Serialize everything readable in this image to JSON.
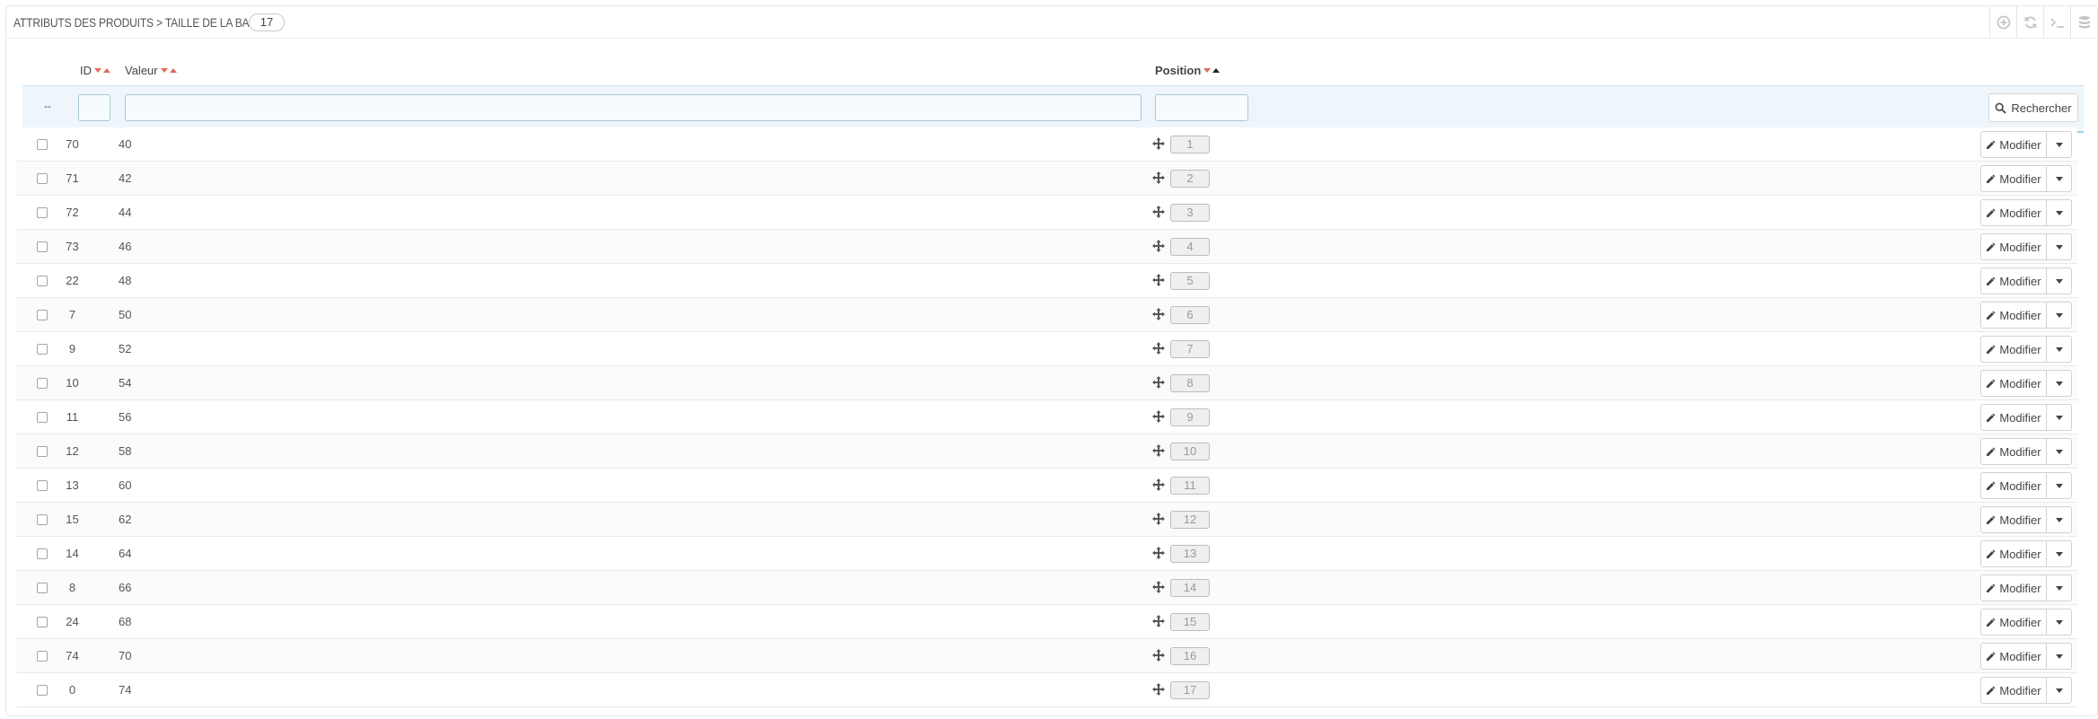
{
  "header": {
    "title": "ATTRIBUTS DES PRODUITS > TAILLE DE LA BAGUE",
    "count": "17",
    "tools": [
      "add-icon",
      "refresh-icon",
      "sql-icon",
      "database-icon"
    ]
  },
  "columns": {
    "id": "ID",
    "value": "Valeur",
    "position": "Position"
  },
  "filters": {
    "bulk_placeholder": "--",
    "search_label": "Rechercher"
  },
  "actions": {
    "edit_label": "Modifier"
  },
  "rows": [
    {
      "id": "70",
      "value": "40",
      "position": "1"
    },
    {
      "id": "71",
      "value": "42",
      "position": "2"
    },
    {
      "id": "72",
      "value": "44",
      "position": "3"
    },
    {
      "id": "73",
      "value": "46",
      "position": "4"
    },
    {
      "id": "22",
      "value": "48",
      "position": "5"
    },
    {
      "id": "7",
      "value": "50",
      "position": "6"
    },
    {
      "id": "9",
      "value": "52",
      "position": "7"
    },
    {
      "id": "10",
      "value": "54",
      "position": "8"
    },
    {
      "id": "11",
      "value": "56",
      "position": "9"
    },
    {
      "id": "12",
      "value": "58",
      "position": "10"
    },
    {
      "id": "13",
      "value": "60",
      "position": "11"
    },
    {
      "id": "15",
      "value": "62",
      "position": "12"
    },
    {
      "id": "14",
      "value": "64",
      "position": "13"
    },
    {
      "id": "8",
      "value": "66",
      "position": "14"
    },
    {
      "id": "24",
      "value": "68",
      "position": "15"
    },
    {
      "id": "74",
      "value": "70",
      "position": "16"
    },
    {
      "id": "0",
      "value": "74",
      "position": "17"
    }
  ],
  "colors": {
    "sort_arrow": "#e06b5b",
    "filter_bg": "#eef6fb"
  }
}
